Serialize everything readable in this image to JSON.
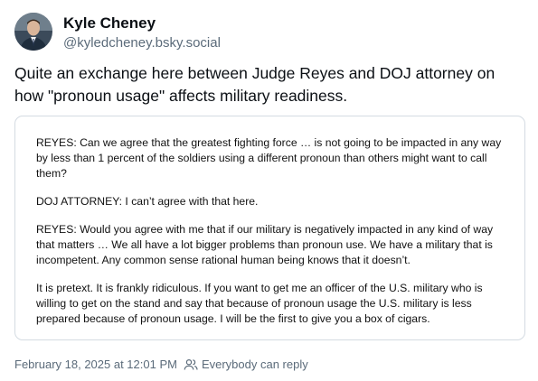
{
  "author": {
    "display_name": "Kyle Cheney",
    "handle": "@kyledcheney.bsky.social"
  },
  "post": {
    "text": "Quite an exchange here between Judge Reyes and DOJ attorney on how \"pronoun usage\" affects military readiness."
  },
  "embed": {
    "paragraphs": [
      "REYES: Can we agree that the greatest fighting force … is not going to be impacted in any way by less than 1 percent of the soldiers using a different pronoun than others might want to call them?",
      "DOJ ATTORNEY: I can’t agree with that here.",
      "REYES: Would you agree with me that if our military is negatively impacted in any kind of way that matters … We all have a lot bigger problems than pronoun use. We have a military that is incompetent. Any common sense rational human being knows that it doesn’t.",
      "It is pretext. It is frankly ridiculous. If you want to get me an officer of the U.S. military who is willing to get on the stand and say that because of pronoun usage the U.S. military is less prepared because of pronoun usage. I will be the first to give you a box of cigars."
    ]
  },
  "footer": {
    "timestamp": "February 18, 2025 at 12:01 PM",
    "reply_setting": "Everybody can reply",
    "icon": "people-icon"
  },
  "colors": {
    "text": "#0b0f14",
    "muted": "#5b6b7a",
    "border": "#d4dbe2"
  }
}
